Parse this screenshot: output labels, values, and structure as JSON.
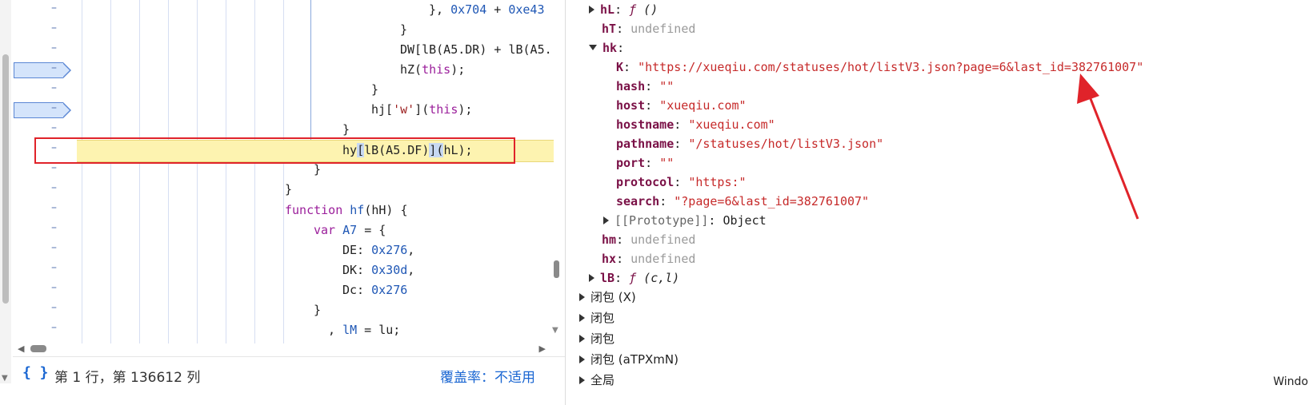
{
  "editor": {
    "lines": [
      {
        "text": "}, 0x704 + 0xe43"
      },
      {
        "text": "}"
      },
      {
        "text": "DW[lB(A5.DR) + lB(A5."
      },
      {
        "text": "hZ(this);"
      },
      {
        "text": "}"
      },
      {
        "text": "hj['w'](this);"
      },
      {
        "text": "}"
      },
      {
        "text": "hy[lB(A5.DF)](hL);"
      },
      {
        "text": "}"
      },
      {
        "text": "}"
      },
      {
        "text": "function hf(hH) {"
      },
      {
        "text": "var A7 = {"
      },
      {
        "text": "DE: 0x276,"
      },
      {
        "text": "DK: 0x30d,"
      },
      {
        "text": "Dc: 0x276"
      },
      {
        "text": "}"
      },
      {
        "text": ", lM = lu;"
      }
    ],
    "gutter_marker": "–",
    "paused_line": "hy[lB(A5.DF)](hL);"
  },
  "statusbar": {
    "braces_icon": "{ }",
    "cursor_position": "第 1 行，第 136612 列",
    "coverage": "覆盖率：不适用"
  },
  "scope": {
    "rows": [
      {
        "key": "hL",
        "value": "ƒ ()",
        "kind": "function",
        "expander": "collapsed"
      },
      {
        "key": "hT",
        "value": "undefined",
        "kind": "undefined",
        "expander": "none"
      },
      {
        "key": "hk",
        "value": "",
        "kind": "object",
        "expander": "expanded"
      },
      {
        "key": "K",
        "value": "\"https://xueqiu.com/statuses/hot/listV3.json?page=6&last_id=382761007\"",
        "kind": "string",
        "expander": "none"
      },
      {
        "key": "hash",
        "value": "\"\"",
        "kind": "string",
        "expander": "none"
      },
      {
        "key": "host",
        "value": "\"xueqiu.com\"",
        "kind": "string",
        "expander": "none"
      },
      {
        "key": "hostname",
        "value": "\"xueqiu.com\"",
        "kind": "string",
        "expander": "none"
      },
      {
        "key": "pathname",
        "value": "\"/statuses/hot/listV3.json\"",
        "kind": "string",
        "expander": "none"
      },
      {
        "key": "port",
        "value": "\"\"",
        "kind": "string",
        "expander": "none"
      },
      {
        "key": "protocol",
        "value": "\"https:\"",
        "kind": "string",
        "expander": "none"
      },
      {
        "key": "search",
        "value": "\"?page=6&last_id=382761007\"",
        "kind": "string",
        "expander": "none"
      },
      {
        "key": "[[Prototype]]",
        "value": "Object",
        "kind": "proto",
        "expander": "collapsed"
      },
      {
        "key": "hm",
        "value": "undefined",
        "kind": "undefined",
        "expander": "none"
      },
      {
        "key": "hx",
        "value": "undefined",
        "kind": "undefined",
        "expander": "none"
      },
      {
        "key": "lB",
        "value": "ƒ (c,l)",
        "kind": "function",
        "expander": "collapsed"
      }
    ],
    "closures": [
      {
        "label": "闭包 (X)"
      },
      {
        "label": "闭包"
      },
      {
        "label": "闭包"
      },
      {
        "label": "闭包 (aTPXmN)"
      },
      {
        "label": "全局"
      }
    ],
    "global_value": "Windo"
  },
  "annotation": {
    "arrow_color": "#e0232a",
    "box_color": "#e0232a"
  }
}
